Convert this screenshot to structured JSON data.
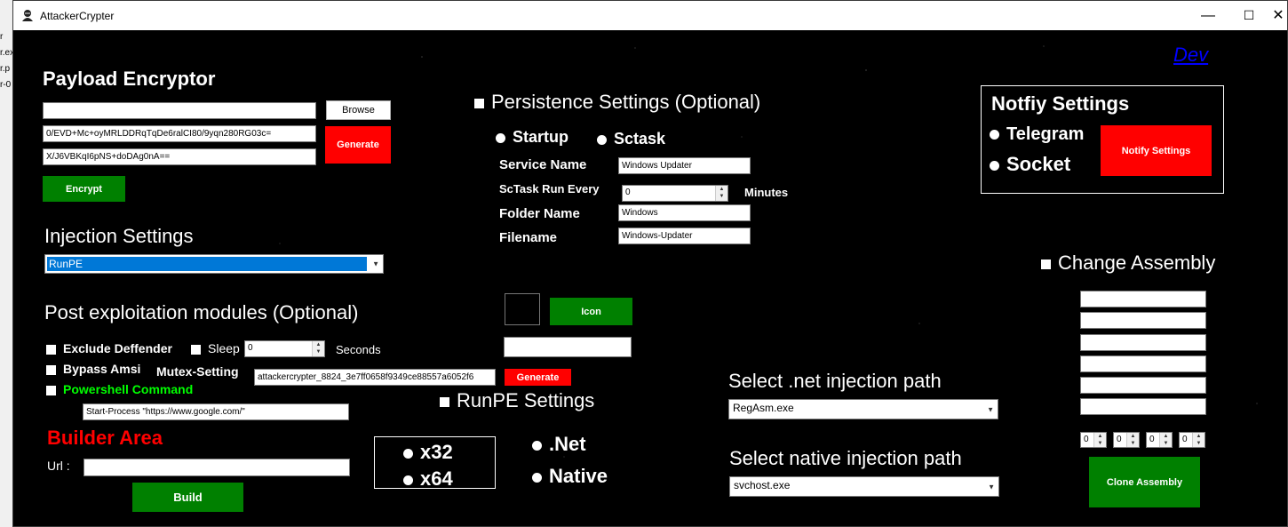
{
  "window": {
    "title": "AttackerCrypter",
    "minimize": "—",
    "maximize": "☐",
    "close": "✕"
  },
  "desktop": [
    "r",
    "r.ex",
    "r.p",
    "r-0"
  ],
  "dev_link": "Dev",
  "payload": {
    "title": "Payload Encryptor",
    "path_value": "",
    "key1": "0/EVD+Mc+oyMRLDDRqTqDe6ralCI80/9yqn280RG03c=",
    "key2": "X/J6VBKqI6pNS+doDAg0nA==",
    "browse": "Browse",
    "generate": "Generate",
    "encrypt": "Encrypt"
  },
  "injection": {
    "title": "Injection Settings",
    "selected": "RunPE"
  },
  "post": {
    "title": "Post exploitation modules (Optional)",
    "exclude_defender": "Exclude Deffender",
    "sleep": "Sleep",
    "sleep_value": "0",
    "seconds": "Seconds",
    "bypass_amsi": "Bypass Amsi",
    "mutex_label": "Mutex-Setting",
    "mutex_value": "attackercrypter_8824_3e7ff0658f9349ce88557a6052f6",
    "mutex_generate": "Generate",
    "powershell": "Powershell Command",
    "powershell_value": "Start-Process \"https://www.google.com/\""
  },
  "builder": {
    "title": "Builder Area",
    "url_label": "Url :",
    "url_value": "",
    "build": "Build"
  },
  "arch": {
    "x32": "x32",
    "x64": "x64"
  },
  "persistence": {
    "title": "Persistence Settings (Optional)",
    "startup": "Startup",
    "sctask": "Sctask",
    "service_name_label": "Service Name",
    "service_name": "Windows Updater",
    "sctask_every_label": "ScTask Run Every",
    "sctask_every": "0",
    "minutes": "Minutes",
    "folder_name_label": "Folder Name",
    "folder_name": "Windows",
    "filename_label": "Filename",
    "filename": "Windows-Updater"
  },
  "icon": {
    "button": "Icon",
    "path_value": ""
  },
  "runpe": {
    "title": "RunPE Settings",
    "net": ".Net",
    "native": "Native"
  },
  "net_path": {
    "title": "Select .net injection path",
    "selected": "RegAsm.exe"
  },
  "native_path": {
    "title": "Select native injection path",
    "selected": "svchost.exe"
  },
  "notify": {
    "title": "Notfiy Settings",
    "telegram": "Telegram",
    "socket": "Socket",
    "button": "Notify Settings"
  },
  "assembly": {
    "title": "Change Assembly",
    "fields": [
      "",
      "",
      "",
      "",
      "",
      ""
    ],
    "versions": [
      "0",
      "0",
      "0",
      "0"
    ],
    "clone": "Clone Assembly"
  },
  "colors": {
    "green": "#008000",
    "red": "#ff0000",
    "selection": "#0078d7",
    "heading_red": "#ff0000",
    "powershell_green": "#00ff00",
    "dev_link": "#0000ff"
  }
}
